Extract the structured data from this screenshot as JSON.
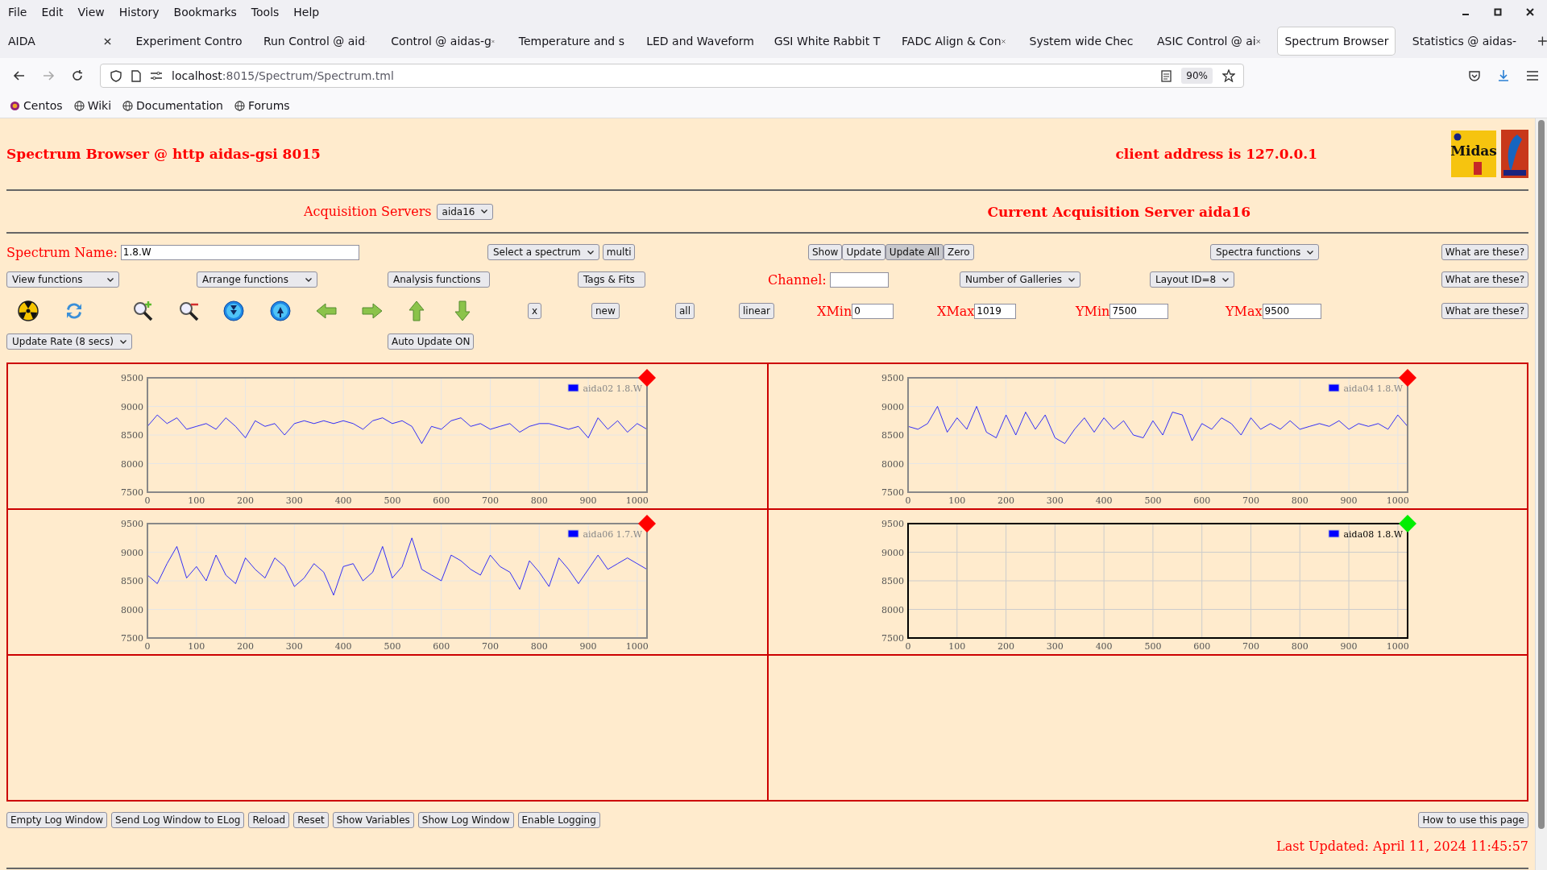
{
  "menu": [
    "File",
    "Edit",
    "View",
    "History",
    "Bookmarks",
    "Tools",
    "Help"
  ],
  "tabs": [
    {
      "title": "AIDA",
      "selected": false
    },
    {
      "title": "Experiment Contro",
      "selected": false
    },
    {
      "title": "Run Control @ aid",
      "selected": false
    },
    {
      "title": "Control @ aidas-g",
      "selected": false
    },
    {
      "title": "Temperature and s",
      "selected": false
    },
    {
      "title": "LED and Waveform",
      "selected": false
    },
    {
      "title": "GSI White Rabbit T",
      "selected": false
    },
    {
      "title": "FADC Align & Con",
      "selected": false
    },
    {
      "title": "System wide Chec",
      "selected": false
    },
    {
      "title": "ASIC Control @ ai",
      "selected": false
    },
    {
      "title": "Spectrum Browser",
      "selected": true
    },
    {
      "title": "Statistics @ aidas-",
      "selected": false
    }
  ],
  "url": {
    "host": "localhost",
    "path": ":8015/Spectrum/Spectrum.tml"
  },
  "zoom": "90%",
  "bookmarks": [
    "Centos",
    "Wiki",
    "Documentation",
    "Forums"
  ],
  "page": {
    "title": "Spectrum Browser @ http aidas-gsi 8015",
    "client": "client address is 127.0.0.1",
    "logo": "Midas",
    "acq_label": "Acquisition Servers",
    "acq_select": "aida16",
    "current_server": "Current Acquisition Server aida16",
    "spectrum_label": "Spectrum Name:",
    "spectrum_value": "1.8.W",
    "select_spectrum": "Select a spectrum",
    "multi": "multi",
    "show_buttons": [
      {
        "label": "Show",
        "selected": false
      },
      {
        "label": "Update",
        "selected": false
      },
      {
        "label": "Update All",
        "selected": true
      },
      {
        "label": "Zero",
        "selected": false
      }
    ],
    "spectra_functions": "Spectra functions",
    "help": [
      "What are these?",
      "What are these?",
      "What are these?"
    ],
    "selects": [
      "View functions",
      "Arrange functions",
      "Analysis functions",
      "Tags & Fits"
    ],
    "channel_label": "Channel:",
    "galleries_select": "Number of Galleries",
    "layout_select": "Layout ID=8",
    "small_buttons": [
      "x",
      "new",
      "all",
      "linear"
    ],
    "ranges": [
      {
        "label": "XMin",
        "value": "0"
      },
      {
        "label": "XMax",
        "value": "1019"
      },
      {
        "label": "YMin",
        "value": "7500"
      },
      {
        "label": "YMax",
        "value": "9500"
      }
    ],
    "update_rate": "Update Rate (8 secs)",
    "auto_update": "Auto Update ON"
  },
  "galleries": [
    {
      "color": "#ff0000",
      "selected": false,
      "chart_data": {
        "type": "line",
        "grid": true,
        "xlim": [
          0,
          1020
        ],
        "ylim": [
          7500,
          9500
        ],
        "xticks": [
          0,
          100,
          200,
          300,
          400,
          500,
          600,
          700,
          800,
          900,
          1000
        ],
        "yticks": [
          9500,
          9000,
          8500,
          8000,
          7500
        ],
        "x": [
          0,
          20,
          40,
          60,
          80,
          100,
          120,
          140,
          160,
          180,
          200,
          220,
          240,
          260,
          280,
          300,
          320,
          340,
          360,
          380,
          400,
          420,
          440,
          460,
          480,
          500,
          520,
          540,
          560,
          580,
          600,
          620,
          640,
          660,
          680,
          700,
          720,
          740,
          760,
          780,
          800,
          820,
          840,
          860,
          880,
          900,
          920,
          940,
          960,
          980,
          1000,
          1020
        ],
        "series": [
          {
            "name": "aida02 1.8.W",
            "color": "#0000ff",
            "values": [
              8650,
              8850,
              8700,
              8800,
              8600,
              8650,
              8700,
              8600,
              8800,
              8650,
              8450,
              8750,
              8650,
              8700,
              8500,
              8700,
              8750,
              8700,
              8750,
              8700,
              8750,
              8700,
              8600,
              8750,
              8800,
              8700,
              8750,
              8650,
              8350,
              8650,
              8600,
              8750,
              8800,
              8650,
              8700,
              8600,
              8650,
              8700,
              8550,
              8650,
              8700,
              8700,
              8650,
              8600,
              8650,
              8450,
              8800,
              8600,
              8750,
              8550,
              8700,
              8600
            ]
          }
        ]
      }
    },
    {
      "color": "#ff0000",
      "selected": false,
      "chart_data": {
        "type": "line",
        "grid": true,
        "xlim": [
          0,
          1020
        ],
        "ylim": [
          7500,
          9500
        ],
        "xticks": [
          0,
          100,
          200,
          300,
          400,
          500,
          600,
          700,
          800,
          900,
          1000
        ],
        "yticks": [
          9500,
          9000,
          8500,
          8000,
          7500
        ],
        "x": [
          0,
          20,
          40,
          60,
          80,
          100,
          120,
          140,
          160,
          180,
          200,
          220,
          240,
          260,
          280,
          300,
          320,
          340,
          360,
          380,
          400,
          420,
          440,
          460,
          480,
          500,
          520,
          540,
          560,
          580,
          600,
          620,
          640,
          660,
          680,
          700,
          720,
          740,
          760,
          780,
          800,
          820,
          840,
          860,
          880,
          900,
          920,
          940,
          960,
          980,
          1000,
          1020
        ],
        "series": [
          {
            "name": "aida04 1.8.W",
            "color": "#0000ff",
            "values": [
              8650,
              8600,
              8700,
              9000,
              8550,
              8800,
              8600,
              9000,
              8550,
              8450,
              8850,
              8500,
              8900,
              8600,
              8850,
              8450,
              8350,
              8600,
              8800,
              8550,
              8800,
              8600,
              8750,
              8500,
              8450,
              8750,
              8500,
              8900,
              8850,
              8400,
              8700,
              8600,
              8800,
              8700,
              8500,
              8800,
              8600,
              8700,
              8600,
              8750,
              8600,
              8650,
              8700,
              8650,
              8750,
              8600,
              8700,
              8650,
              8700,
              8600,
              8850,
              8650
            ]
          }
        ]
      }
    },
    {
      "color": "#ff0000",
      "selected": false,
      "chart_data": {
        "type": "line",
        "grid": true,
        "xlim": [
          0,
          1020
        ],
        "ylim": [
          7500,
          9500
        ],
        "xticks": [
          0,
          100,
          200,
          300,
          400,
          500,
          600,
          700,
          800,
          900,
          1000
        ],
        "yticks": [
          9500,
          9000,
          8500,
          8000,
          7500
        ],
        "x": [
          0,
          20,
          40,
          60,
          80,
          100,
          120,
          140,
          160,
          180,
          200,
          220,
          240,
          260,
          280,
          300,
          320,
          340,
          360,
          380,
          400,
          420,
          440,
          460,
          480,
          500,
          520,
          540,
          560,
          580,
          600,
          620,
          640,
          660,
          680,
          700,
          720,
          740,
          760,
          780,
          800,
          820,
          840,
          860,
          880,
          900,
          920,
          940,
          960,
          980,
          1000,
          1020
        ],
        "series": [
          {
            "name": "aida06 1.7.W",
            "color": "#0000ff",
            "values": [
              8600,
              8450,
              8800,
              9100,
              8550,
              8750,
              8500,
              8950,
              8600,
              8450,
              8900,
              8700,
              8550,
              8900,
              8750,
              8400,
              8550,
              8800,
              8650,
              8250,
              8750,
              8800,
              8500,
              8650,
              9100,
              8550,
              8750,
              9250,
              8700,
              8600,
              8500,
              8950,
              8850,
              8700,
              8600,
              8950,
              8750,
              8650,
              8350,
              8850,
              8650,
              8400,
              8900,
              8700,
              8450,
              8700,
              8950,
              8700,
              8800,
              8900,
              8800,
              8700
            ]
          }
        ]
      }
    },
    {
      "color": "#00ee00",
      "selected": true,
      "empty_plot": {
        "legend": "aida08 1.8.W",
        "yticks": [
          "9500",
          "9000",
          "8500",
          "8000",
          "7500"
        ],
        "xticks": [
          "0",
          "100",
          "200",
          "300",
          "400",
          "500",
          "600",
          "700",
          "800",
          "900",
          "1000"
        ]
      }
    }
  ],
  "log_buttons": [
    "Empty Log Window",
    "Send Log Window to ELog",
    "Reload",
    "Reset",
    "Show Variables",
    "Show Log Window",
    "Enable Logging"
  ],
  "how_to": "How to use this page",
  "last_updated": "Last Updated: April 11, 2024 11:45:57"
}
